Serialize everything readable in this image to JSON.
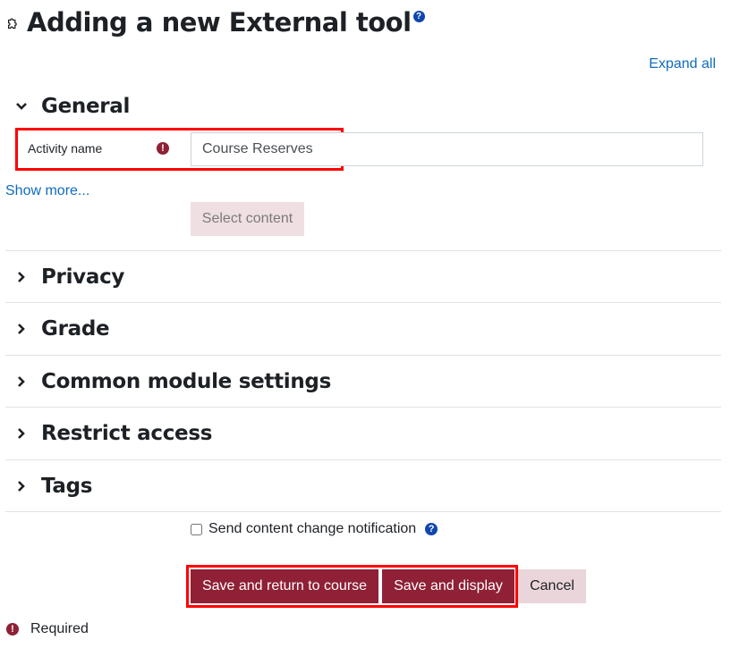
{
  "header": {
    "title": "Adding a new External tool",
    "title_icon": "puzzle-icon",
    "help_icon": "help-icon",
    "help_glyph": "?"
  },
  "toolbar": {
    "expand_all_label": "Expand all"
  },
  "sections": [
    {
      "title": "General",
      "expanded": true
    },
    {
      "title": "Privacy",
      "expanded": false
    },
    {
      "title": "Grade",
      "expanded": false
    },
    {
      "title": "Common module settings",
      "expanded": false
    },
    {
      "title": "Restrict access",
      "expanded": false
    },
    {
      "title": "Tags",
      "expanded": false
    }
  ],
  "general": {
    "activity_name_label": "Activity name",
    "activity_name_value": "Course Reserves",
    "required_glyph": "!",
    "show_more_label": "Show more...",
    "select_content_label": "Select content"
  },
  "notification": {
    "label": "Send content change notification",
    "checked": false,
    "help_glyph": "?"
  },
  "actions": {
    "save_return_label": "Save and return to course",
    "save_display_label": "Save and display",
    "cancel_label": "Cancel"
  },
  "footer": {
    "required_label": "Required",
    "required_glyph": "!"
  },
  "colors": {
    "primary": "#8f2035",
    "link": "#0f6cbf",
    "highlight": "#ff0000"
  }
}
